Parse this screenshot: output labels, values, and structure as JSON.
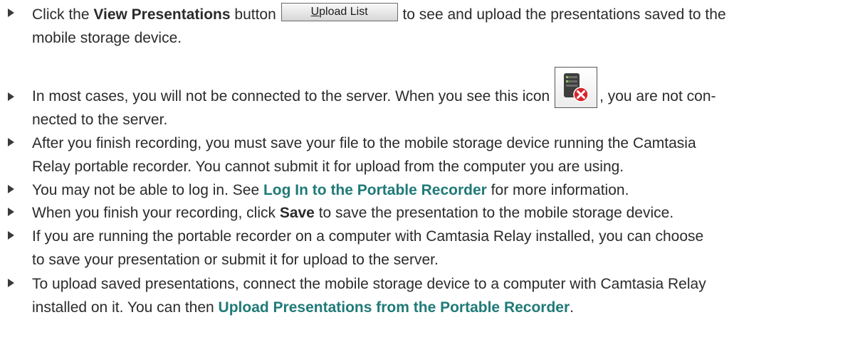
{
  "items": [
    {
      "before": "Click the ",
      "bold": "View Presentations",
      "middle": " button ",
      "button_label_u": "U",
      "button_label_rest": "pload List",
      "after_line1": " to see and upload the presentations saved to the",
      "line2": "mobile storage device."
    },
    {
      "line1_before": "In most cases, you will not be connected to the server. When you see this icon ",
      "line1_after": ", you are not con-",
      "line2": "nected to the server.",
      "icon": "server-disconnected-icon"
    },
    {
      "line1": "After you finish recording, you must save your file to the mobile storage device running the Camtasia",
      "line2": "Relay portable recorder. You cannot submit it for upload from the computer you are using."
    },
    {
      "before": "You may not be able to log in. See ",
      "link": "Log In to the Portable Recorder",
      "after": " for more information."
    },
    {
      "before": "When you finish your recording, click ",
      "bold": "Save",
      "after": " to save the presentation to the mobile storage device."
    },
    {
      "line1": "If you are running the portable recorder on a computer with Camtasia Relay installed, you can choose",
      "line2": "to save your presentation or submit it for upload to the server."
    },
    {
      "line1": "To upload saved presentations, connect the mobile storage device to a computer with Camtasia Relay",
      "line2_before": "installed on it. You can then ",
      "link": "Upload Presentations from the Portable Recorder",
      "line2_after": "."
    }
  ],
  "colors": {
    "text": "#2b2b2b",
    "link": "#1f7a78",
    "bullet": "#3a3a3a",
    "icon_error": "#d8242c"
  }
}
